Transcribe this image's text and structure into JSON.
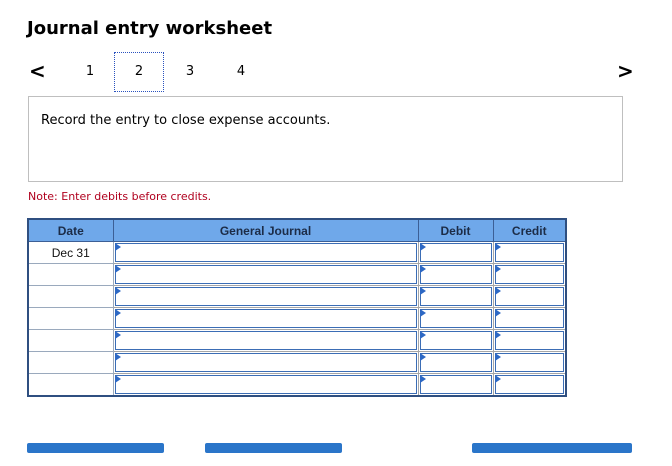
{
  "title": "Journal entry worksheet",
  "nav": {
    "prev_glyph": "<",
    "next_glyph": ">",
    "pages": [
      "1",
      "2",
      "3",
      "4"
    ],
    "active_page": "2"
  },
  "instruction": "Record the entry to close expense accounts.",
  "note": "Note: Enter debits before credits.",
  "table": {
    "headers": [
      "Date",
      "General Journal",
      "Debit",
      "Credit"
    ],
    "rows": [
      {
        "date": "Dec 31",
        "account": "",
        "debit": "",
        "credit": ""
      },
      {
        "date": "",
        "account": "",
        "debit": "",
        "credit": ""
      },
      {
        "date": "",
        "account": "",
        "debit": "",
        "credit": ""
      },
      {
        "date": "",
        "account": "",
        "debit": "",
        "credit": ""
      },
      {
        "date": "",
        "account": "",
        "debit": "",
        "credit": ""
      },
      {
        "date": "",
        "account": "",
        "debit": "",
        "credit": ""
      },
      {
        "date": "",
        "account": "",
        "debit": "",
        "credit": ""
      }
    ]
  },
  "colors": {
    "header_bg": "#6fa8ea",
    "note": "#b0001e",
    "accent": "#2a75c9"
  }
}
